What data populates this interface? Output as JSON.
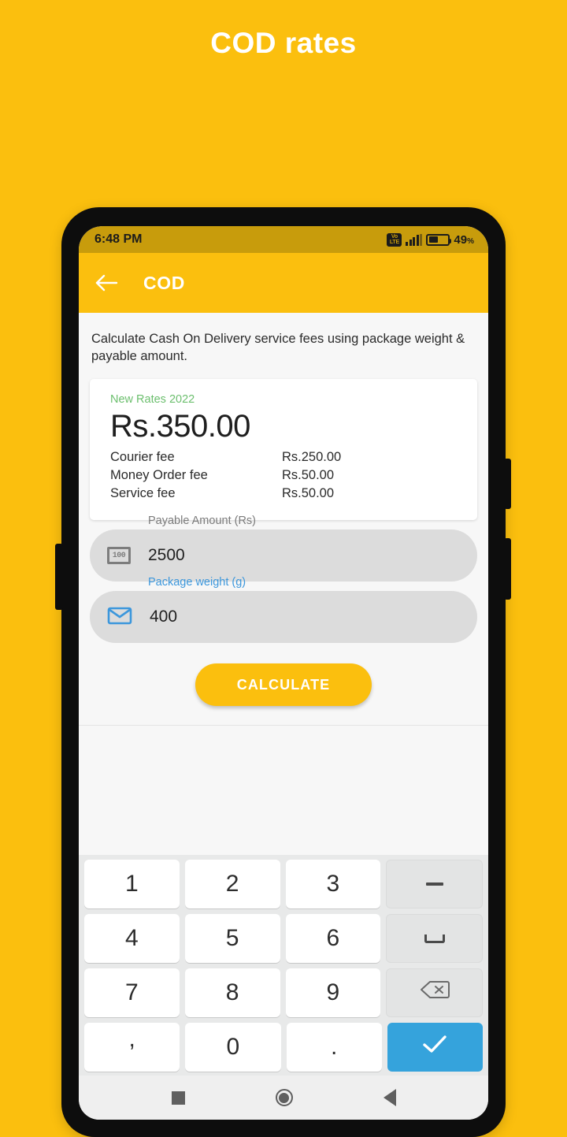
{
  "page": {
    "headline": "COD rates",
    "background_color": "#FBBF0E"
  },
  "status_bar": {
    "time": "6:48 PM",
    "network_badge_top": "Vo",
    "network_badge_bottom": "LTE",
    "battery_percent": "49",
    "percent_symbol": "%",
    "battery_level": 49
  },
  "app_bar": {
    "back_icon": "arrow-left-icon",
    "title": "COD",
    "background_color": "#FBBF0E"
  },
  "content": {
    "intro": "Calculate Cash On Delivery service fees using package weight & payable amount.",
    "result_card": {
      "rates_label": "New Rates 2022",
      "rates_label_color": "#6CBF6E",
      "total": "Rs.350.00",
      "fees": [
        {
          "name": "Courier fee",
          "value": "Rs.250.00"
        },
        {
          "name": "Money Order fee",
          "value": "Rs.50.00"
        },
        {
          "name": "Service fee",
          "value": "Rs.50.00"
        }
      ]
    },
    "fields": [
      {
        "label": "Payable Amount (Rs)",
        "value": "2500",
        "icon": "money-note-icon",
        "icon_text": "100",
        "label_color": "#7b7b7b",
        "focused": false
      },
      {
        "label": "Package weight (g)",
        "value": "400",
        "icon": "envelope-icon",
        "label_color": "#3C97DC",
        "focused": true
      }
    ],
    "calculate_button": "CALCULATE"
  },
  "keyboard": {
    "rows": [
      [
        {
          "label": "1",
          "name": "key-1",
          "type": "digit"
        },
        {
          "label": "2",
          "name": "key-2",
          "type": "digit"
        },
        {
          "label": "3",
          "name": "key-3",
          "type": "digit"
        },
        {
          "label": "−",
          "name": "key-minus",
          "type": "fn"
        }
      ],
      [
        {
          "label": "4",
          "name": "key-4",
          "type": "digit"
        },
        {
          "label": "5",
          "name": "key-5",
          "type": "digit"
        },
        {
          "label": "6",
          "name": "key-6",
          "type": "digit"
        },
        {
          "label": "",
          "name": "key-space",
          "type": "fn"
        }
      ],
      [
        {
          "label": "7",
          "name": "key-7",
          "type": "digit"
        },
        {
          "label": "8",
          "name": "key-8",
          "type": "digit"
        },
        {
          "label": "9",
          "name": "key-9",
          "type": "digit"
        },
        {
          "label": "",
          "name": "key-backspace",
          "type": "fn"
        }
      ],
      [
        {
          "label": ",",
          "name": "key-comma",
          "type": "digit"
        },
        {
          "label": "0",
          "name": "key-0",
          "type": "digit"
        },
        {
          "label": ".",
          "name": "key-period",
          "type": "digit"
        },
        {
          "label": "",
          "name": "key-enter",
          "type": "enter"
        }
      ]
    ],
    "enter_color": "#35A3DC",
    "background_color": "#E8E9E9"
  },
  "nav_bar": {
    "recents": "square-icon",
    "home": "circle-icon",
    "back": "triangle-left-icon"
  }
}
